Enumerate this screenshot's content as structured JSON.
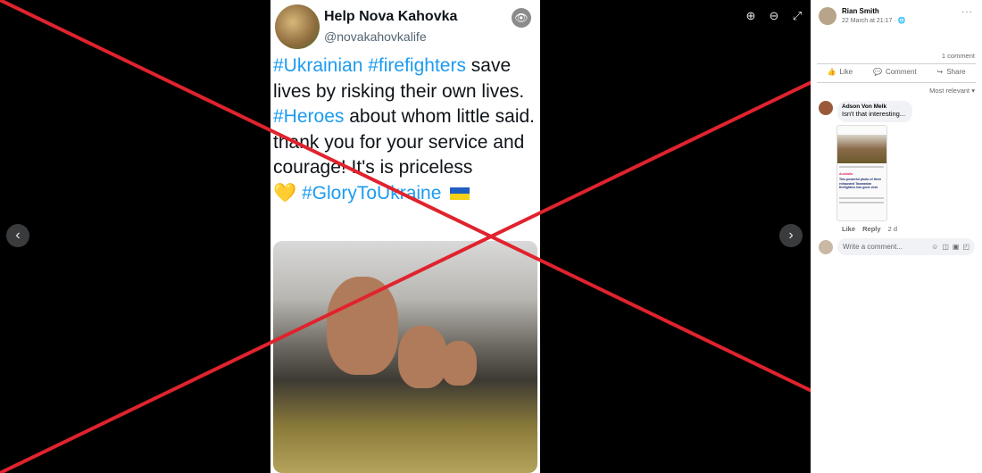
{
  "viewer": {
    "prev_icon": "chevron-left-icon",
    "next_icon": "chevron-right-icon",
    "prev_glyph": "‹",
    "next_glyph": "›",
    "zoom_in_glyph": "⊕",
    "zoom_out_glyph": "⊖",
    "fullscreen_glyph": "⤢"
  },
  "tweet": {
    "account_name": "Help Nova Kahovka",
    "handle": "@novakahovkalife",
    "eye_glyph": "👁",
    "text": {
      "tag1": "#Ukrainian",
      "tag2": "#firefighters",
      "part1": "save lives by risking their own lives.",
      "tag3": "#Heroes",
      "part2": "about whom little said.",
      "line2": "thank you for your service and courage! It's is priceless",
      "heart": "💛",
      "tag4": "#GloryToUkraine"
    }
  },
  "colors": {
    "x_overlay": "#e0232d",
    "link": "#1d9bf0"
  },
  "post": {
    "author": "Rian Smith",
    "date": "22 March at 21:17 · ",
    "globe": "🌐",
    "more": "···",
    "comment_count": "1 comment",
    "actions": {
      "like": "Like",
      "comment": "Comment",
      "share": "Share"
    },
    "sort_label": "Most relevant ▾"
  },
  "comment": {
    "author": "Adson Von Melk",
    "text": "Isn't that interesting...",
    "thumb_category": "Australia",
    "thumb_title": "This powerful photo of three exhausted Tasmanian firefighters has gone viral",
    "like": "Like",
    "reply": "Reply",
    "age": "2 d"
  },
  "composer": {
    "placeholder": "Write a comment...",
    "icons": [
      "emoji-icon",
      "camera-icon",
      "gif-icon",
      "sticker-icon"
    ]
  }
}
